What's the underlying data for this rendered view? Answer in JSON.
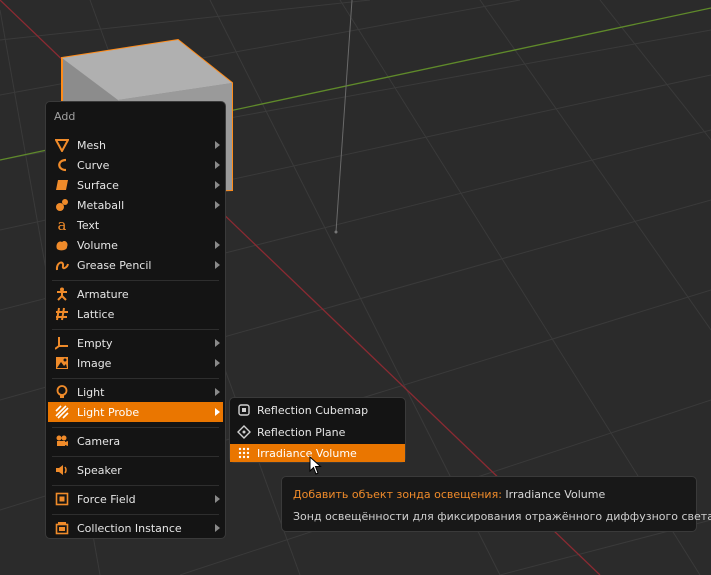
{
  "menu": {
    "title": "Add",
    "items": [
      {
        "label": "Mesh",
        "icon": "mesh-icon",
        "submenu": true
      },
      {
        "label": "Curve",
        "icon": "curve-icon",
        "submenu": true
      },
      {
        "label": "Surface",
        "icon": "surface-icon",
        "submenu": true
      },
      {
        "label": "Metaball",
        "icon": "metaball-icon",
        "submenu": true
      },
      {
        "label": "Text",
        "icon": "text-icon",
        "submenu": false
      },
      {
        "label": "Volume",
        "icon": "volume-icon",
        "submenu": true
      },
      {
        "label": "Grease Pencil",
        "icon": "grease-pencil-icon",
        "submenu": true
      },
      {
        "label": "Armature",
        "icon": "armature-icon",
        "submenu": false
      },
      {
        "label": "Lattice",
        "icon": "lattice-icon",
        "submenu": false
      },
      {
        "label": "Empty",
        "icon": "empty-icon",
        "submenu": true
      },
      {
        "label": "Image",
        "icon": "image-icon",
        "submenu": true
      },
      {
        "label": "Light",
        "icon": "light-icon",
        "submenu": true
      },
      {
        "label": "Light Probe",
        "icon": "light-probe-icon",
        "submenu": true,
        "active": true
      },
      {
        "label": "Camera",
        "icon": "camera-icon",
        "submenu": false
      },
      {
        "label": "Speaker",
        "icon": "speaker-icon",
        "submenu": false
      },
      {
        "label": "Force Field",
        "icon": "force-field-icon",
        "submenu": true
      },
      {
        "label": "Collection Instance",
        "icon": "collection-instance-icon",
        "submenu": true
      }
    ]
  },
  "submenu": {
    "items": [
      {
        "label": "Reflection Cubemap",
        "icon": "reflection-cubemap-icon"
      },
      {
        "label": "Reflection Plane",
        "icon": "reflection-plane-icon"
      },
      {
        "label": "Irradiance Volume",
        "icon": "irradiance-volume-icon",
        "active": true
      }
    ]
  },
  "tooltip": {
    "title": "Добавить объект зонда освещения:",
    "value": "Irradiance Volume",
    "description": "Зонд освещённости для фиксирования отражённого диффузного света"
  },
  "colors": {
    "accent": "#ea7600",
    "menu_bg": "#141414",
    "viewport_bg": "#2b2b2b",
    "selection_outline": "#ff8c1a"
  }
}
